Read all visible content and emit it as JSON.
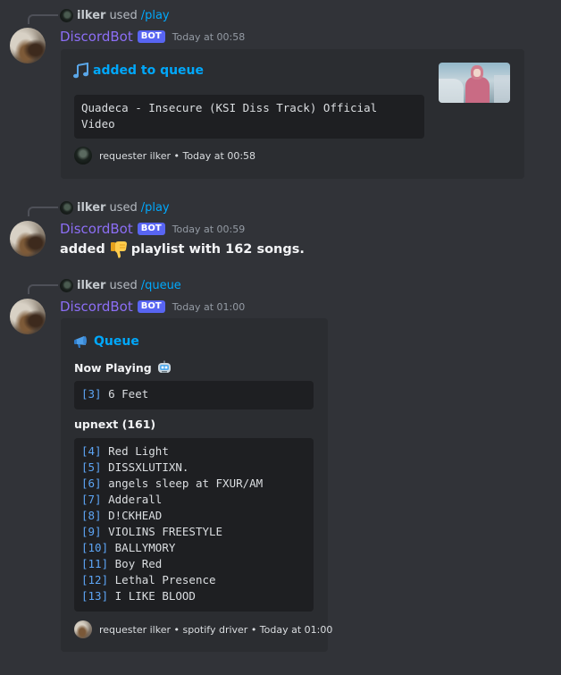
{
  "messages": [
    {
      "reply_user": "ilker",
      "reply_used": "used",
      "reply_command": "/play",
      "author": "DiscordBot",
      "bot_tag": "BOT",
      "timestamp": "Today at 00:58",
      "embed": {
        "title": "added to queue",
        "title_icon": "music-note-icon",
        "code_text": "Quadeca - Insecure (KSI Diss Track) Official\nVideo",
        "footer": "requester ilker • Today at 00:58",
        "thumbnail": "video-thumbnail"
      }
    },
    {
      "reply_user": "ilker",
      "reply_used": "used",
      "reply_command": "/play",
      "author": "DiscordBot",
      "bot_tag": "BOT",
      "timestamp": "Today at 00:59",
      "text_before": "added",
      "text_icon": "thumbs-down-icon",
      "text_after": "playlist with 162 songs."
    },
    {
      "reply_user": "ilker",
      "reply_used": "used",
      "reply_command": "/queue",
      "author": "DiscordBot",
      "bot_tag": "BOT",
      "timestamp": "Today at 01:00",
      "embed": {
        "title": "Queue",
        "title_icon": "megaphone-icon",
        "now_playing_label": "Now Playing",
        "now_playing_icon": "robot-icon",
        "now_playing": {
          "num": "[3]",
          "title": "6 Feet"
        },
        "upnext_label": "upnext (161)",
        "upnext": [
          {
            "num": "[4]",
            "title": "Red Light"
          },
          {
            "num": "[5]",
            "title": "DISSXLUTIXN."
          },
          {
            "num": "[6]",
            "title": "angels sleep at FXUR/AM"
          },
          {
            "num": "[7]",
            "title": "Adderall"
          },
          {
            "num": "[8]",
            "title": "D!CKHEAD"
          },
          {
            "num": "[9]",
            "title": "VIOLINS FREESTYLE"
          },
          {
            "num": "[10]",
            "title": "BALLYMORY"
          },
          {
            "num": "[11]",
            "title": "Boy Red"
          },
          {
            "num": "[12]",
            "title": "Lethal Presence"
          },
          {
            "num": "[13]",
            "title": "I LIKE BLOOD"
          }
        ],
        "footer": "requester ilker • spotify driver • Today at 01:00"
      }
    }
  ],
  "colors": {
    "background": "#313338",
    "embed_bg": "#2b2d31",
    "code_bg": "#1e1f22",
    "link": "#00a8fc",
    "bot_name": "#8c6ef5",
    "bot_tag": "#5865f2",
    "queue_number": "#5da5f5"
  }
}
